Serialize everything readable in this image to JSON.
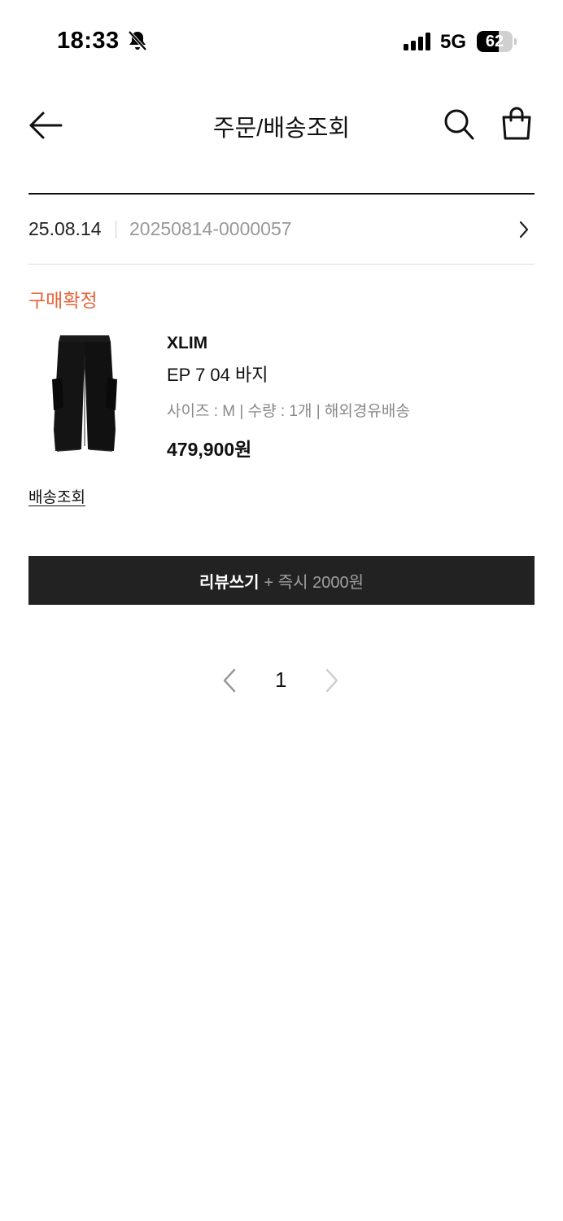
{
  "status_bar": {
    "time": "18:33",
    "network": "5G",
    "battery": "62",
    "battery_level": 0.62
  },
  "header": {
    "title": "주문/배송조회",
    "icons": [
      "back-arrow-icon",
      "search-icon",
      "shopping-bag-icon"
    ]
  },
  "order": {
    "date": "25.08.14",
    "number": "20250814-0000057",
    "status": "구매확정",
    "status_color": "#e8633a"
  },
  "product": {
    "brand": "XLIM",
    "name": "EP 7 04 바지",
    "options": "사이즈 : M | 수량 : 1개 | 해외경유배송",
    "price": "479,900원",
    "image_icon": "black-cargo-pants-image"
  },
  "actions": {
    "track_link": "배송조회",
    "review_button_main": "리뷰쓰기",
    "review_button_extra": "+ 즉시 2000원"
  },
  "pagination": {
    "current_page": "1"
  },
  "colors": {
    "button_bg": "#222222",
    "accent": "#e8633a",
    "muted_text": "#999999"
  }
}
